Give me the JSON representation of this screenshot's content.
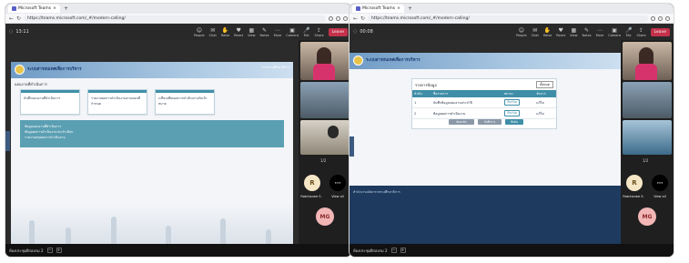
{
  "left": {
    "tab_label": "Microsoft Teams",
    "url": "https://teams.microsoft.com/_#/modern-calling/",
    "call_timer": "13:11",
    "tools": [
      "People",
      "Chat",
      "Raise",
      "React",
      "View",
      "Notes",
      "More",
      "Camera",
      "Mic",
      "Share"
    ],
    "leave_label": "Leave",
    "banner_title": "ระบบสารสนเทศเพื่อการบริหาร",
    "banner_right": "กระทรวงศึกษาธิการ",
    "crumb": "แผนงานที่ดำเนินการ",
    "cards": [
      "บันทึกแผนงานที่ดำเนินการ",
      "รายงานผลการดำเนินงานตามแผนที่กำหนด",
      "เปรียบเทียบผลการดำเนินงานกับเป้าหมาย"
    ],
    "teal_lines": [
      "ข้อมูลแผนงานที่ดำเนินการ",
      "ข้อมูลผลการดำเนินงานประจำเดือน",
      "รายงานสรุปผลการดำเนินงาน"
    ],
    "pager": "1/2",
    "avatar_initial": "R",
    "avatar_name": "Ratchanee S.",
    "view_all": "View all",
    "mg": "MG",
    "bottom_label": "ห้องประชุมฝึกอบรม 2"
  },
  "right": {
    "tab_label": "Microsoft Teams",
    "url": "https://teams.microsoft.com/_#/modern-calling/",
    "call_timer": "00:08",
    "leave_label": "Leave",
    "banner_title": "ระบบสารสนเทศเพื่อการบริหาร",
    "panel_title": "รายการข้อมูล",
    "filter_label": "ทั้งหมด",
    "cols": [
      "ลำดับ",
      "ชื่อรายการ",
      "สถานะ",
      "จัดการ"
    ],
    "rows": [
      {
        "no": "1",
        "name": "บันทึกข้อมูลแผนงานประจำปี",
        "status": "เรียบร้อย",
        "act": "แก้ไข"
      },
      {
        "no": "2",
        "name": "ข้อมูลผลการดำเนินงาน",
        "status": "เรียบร้อย",
        "act": "แก้ไข"
      }
    ],
    "buttons": [
      "ย้อนกลับ",
      "บันทึกร่าง",
      "ยืนยัน"
    ],
    "footer_text": "สำนักงานปลัดกระทรวงศึกษาธิการ",
    "pager": "1/2",
    "avatar_initial": "R",
    "avatar_name": "Ratchanee S.",
    "view_all": "View all",
    "mg": "MG",
    "bottom_label": "ห้องประชุมฝึกอบรม 2"
  },
  "colors": {
    "teal": "#3f8ea8",
    "leave": "#c4314b",
    "teams_bg": "#292929",
    "avatar_mg": "#f2b6b6"
  }
}
